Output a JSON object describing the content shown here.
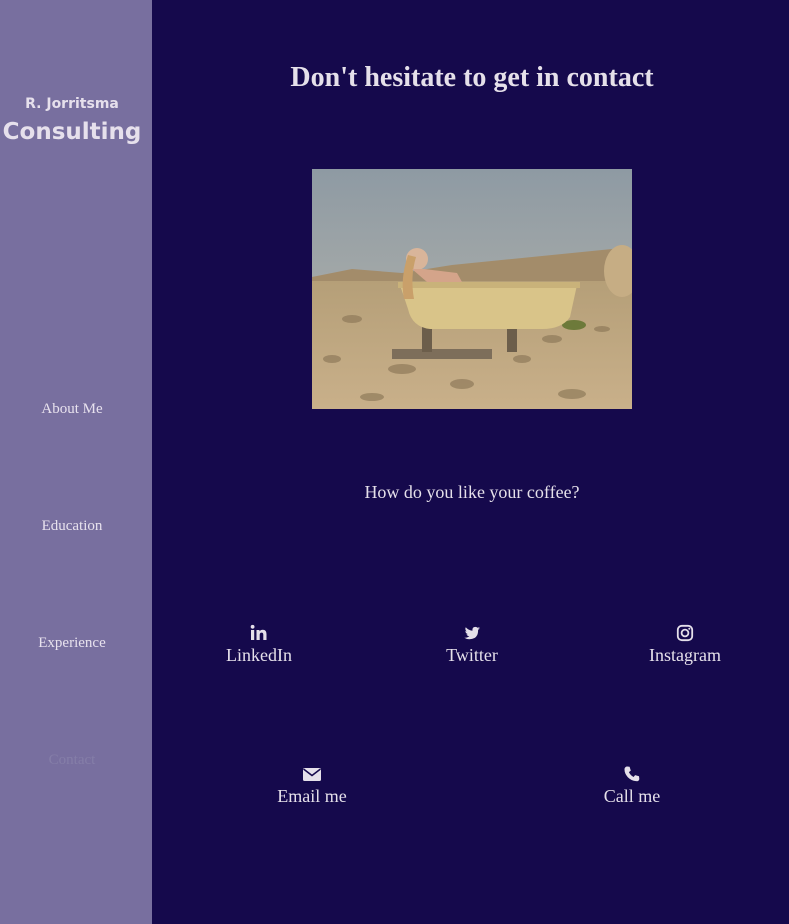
{
  "sidebar": {
    "brand_small": "R. Jorritsma",
    "brand_large": "Consulting",
    "nav": [
      {
        "label": "About Me"
      },
      {
        "label": "Education"
      },
      {
        "label": "Experience"
      },
      {
        "label": "Contact",
        "active": true
      }
    ]
  },
  "main": {
    "heading": "Don't hesitate to get in contact",
    "question": "How do you like your coffee?",
    "social": [
      {
        "label": "LinkedIn",
        "icon": "linkedin-icon"
      },
      {
        "label": "Twitter",
        "icon": "twitter-icon"
      },
      {
        "label": "Instagram",
        "icon": "instagram-icon"
      }
    ],
    "contact": [
      {
        "label": "Email me",
        "icon": "envelope-icon"
      },
      {
        "label": "Call me",
        "icon": "phone-icon"
      }
    ]
  },
  "colors": {
    "background": "#15094c",
    "sidebar": "#786f9f",
    "text": "#e5e0ea",
    "active_nav": "#857ea8"
  }
}
